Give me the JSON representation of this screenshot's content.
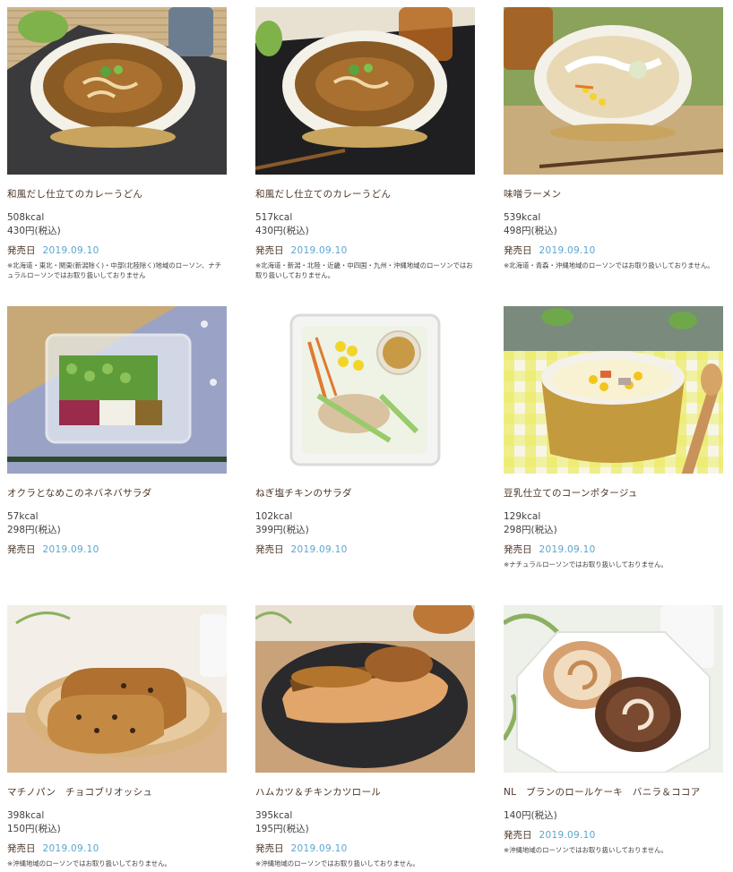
{
  "products": [
    {
      "name": "和風だし仕立てのカレーうどん",
      "kcal": "508kcal",
      "price": "430円(税込)",
      "date_label": "発売日",
      "date": "2019.09.10",
      "note": "※北海道・東北・関東(新潟除く)・中部(北陸除く)地域のローソン、ナチュラルローソンではお取り扱いしておりません",
      "image": "curry-udon-bowl"
    },
    {
      "name": "和風だし仕立てのカレーうどん",
      "kcal": "517kcal",
      "price": "430円(税込)",
      "date_label": "発売日",
      "date": "2019.09.10",
      "note": "※北海道・新潟・北陸・近畿・中四国・九州・沖縄地域のローソンではお取り扱いしておりません。",
      "image": "curry-udon-bowl"
    },
    {
      "name": "味噌ラーメン",
      "kcal": "539kcal",
      "price": "498円(税込)",
      "date_label": "発売日",
      "date": "2019.09.10",
      "note": "※北海道・青森・沖縄地域のローソンではお取り扱いしておりません。",
      "image": "miso-ramen-bowl"
    },
    {
      "name": "オクラとなめこのネバネバサラダ",
      "kcal": "57kcal",
      "price": "298円(税込)",
      "date_label": "発売日",
      "date": "2019.09.10",
      "note": "",
      "image": "okra-salad-container"
    },
    {
      "name": "ねぎ塩チキンのサラダ",
      "kcal": "102kcal",
      "price": "399円(税込)",
      "date_label": "発売日",
      "date": "2019.09.10",
      "note": "",
      "image": "chicken-salad-container"
    },
    {
      "name": "豆乳仕立てのコーンポタージュ",
      "kcal": "129kcal",
      "price": "298円(税込)",
      "date_label": "発売日",
      "date": "2019.09.10",
      "note": "※ナチュラルローソンではお取り扱いしておりません。",
      "image": "corn-soup-cup"
    },
    {
      "name": "マチノパン　チョコブリオッシュ",
      "kcal": "398kcal",
      "price": "150円(税込)",
      "date_label": "発売日",
      "date": "2019.09.10",
      "note": "※沖縄地域のローソンではお取り扱いしておりません。",
      "image": "choco-brioche"
    },
    {
      "name": "ハムカツ＆チキンカツロール",
      "kcal": "395kcal",
      "price": "195円(税込)",
      "date_label": "発売日",
      "date": "2019.09.10",
      "note": "※沖縄地域のローソンではお取り扱いしておりません。",
      "image": "katsu-roll"
    },
    {
      "name": "NL　ブランのロールケーキ　バニラ＆ココア",
      "kcal": "",
      "price": "140円(税込)",
      "date_label": "発売日",
      "date": "2019.09.10",
      "note": "※沖縄地域のローソンではお取り扱いしておりません。",
      "image": "roll-cake"
    }
  ],
  "colors": {
    "text": "#4a3426",
    "date": "#5aa6cf",
    "body_text": "#3f3f3f"
  }
}
